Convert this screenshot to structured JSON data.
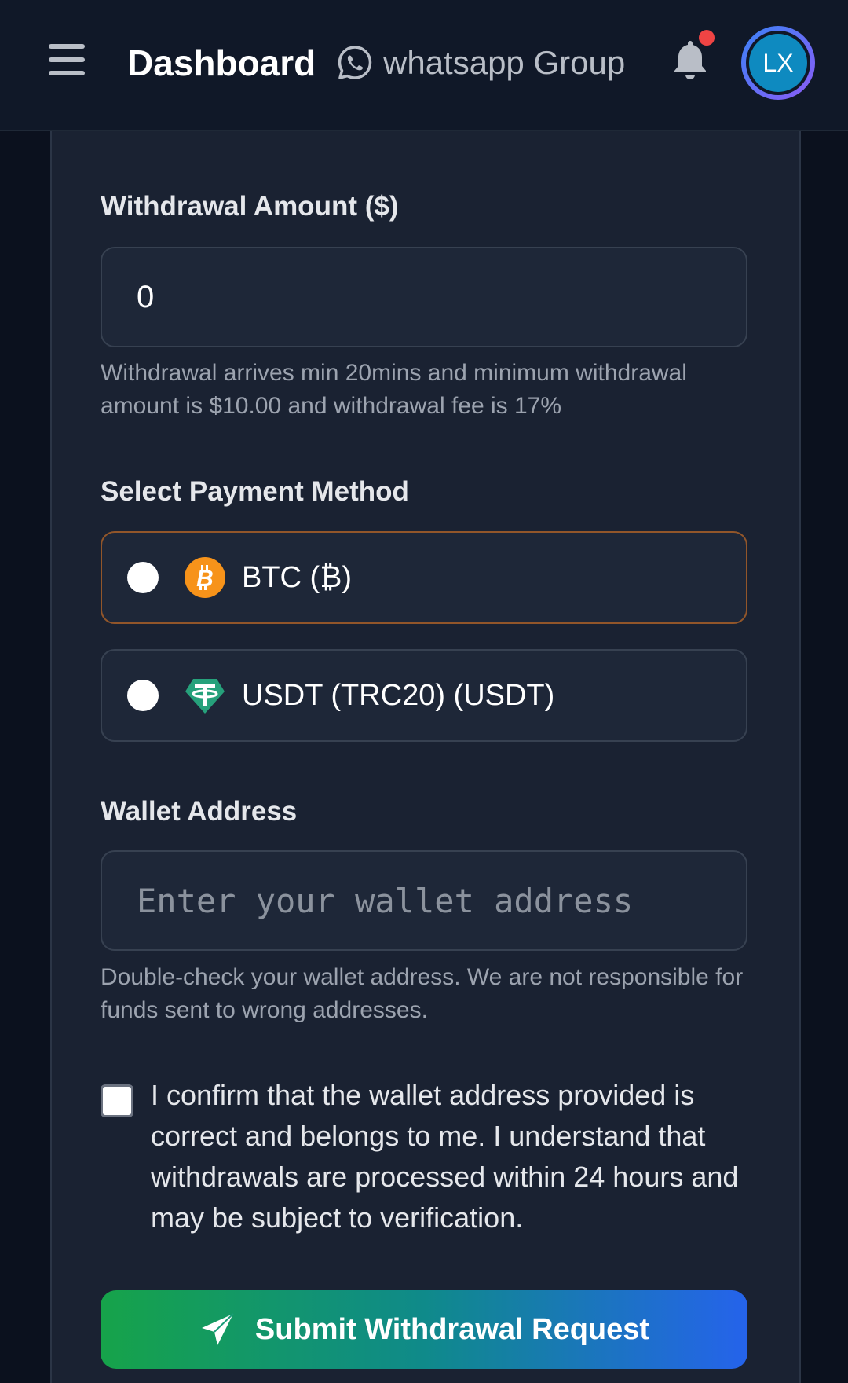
{
  "header": {
    "title": "Dashboard",
    "whatsapp_link": "whatsapp Group",
    "avatar_initials": "LX",
    "notification_dot_color": "#ef4444",
    "icons": {
      "menu": "hamburger-menu-icon",
      "whatsapp": "whatsapp-icon",
      "bell": "bell-icon"
    }
  },
  "form": {
    "amount": {
      "label": "Withdrawal Amount ($)",
      "value": "0",
      "help": "Withdrawal arrives min 20mins and minimum withdrawal amount is $10.00 and withdrawal fee is 17%"
    },
    "payment": {
      "label": "Select Payment Method",
      "options": [
        {
          "label": "BTC (₿)",
          "icon": "bitcoin-icon",
          "color": "#f7931a",
          "highlighted": true
        },
        {
          "label": "USDT (TRC20) (USDT)",
          "icon": "tether-icon",
          "color": "#26a17b",
          "highlighted": false
        }
      ]
    },
    "wallet": {
      "label": "Wallet Address",
      "placeholder": "Enter your wallet address",
      "help": "Double-check your wallet address. We are not responsible for funds sent to wrong addresses."
    },
    "confirm": {
      "text": "I confirm that the wallet address provided is correct and belongs to me. I understand that withdrawals are processed within 24 hours and may be subject to verification.",
      "checked": false
    },
    "submit": {
      "label": "Submit Withdrawal Request",
      "icon": "send-icon"
    }
  },
  "colors": {
    "background": "#0b111e",
    "card": "#1a2232",
    "accent_btc": "#f7931a",
    "accent_usdt": "#26a17b",
    "submit_gradient": [
      "#16a34a",
      "#2563eb"
    ]
  }
}
